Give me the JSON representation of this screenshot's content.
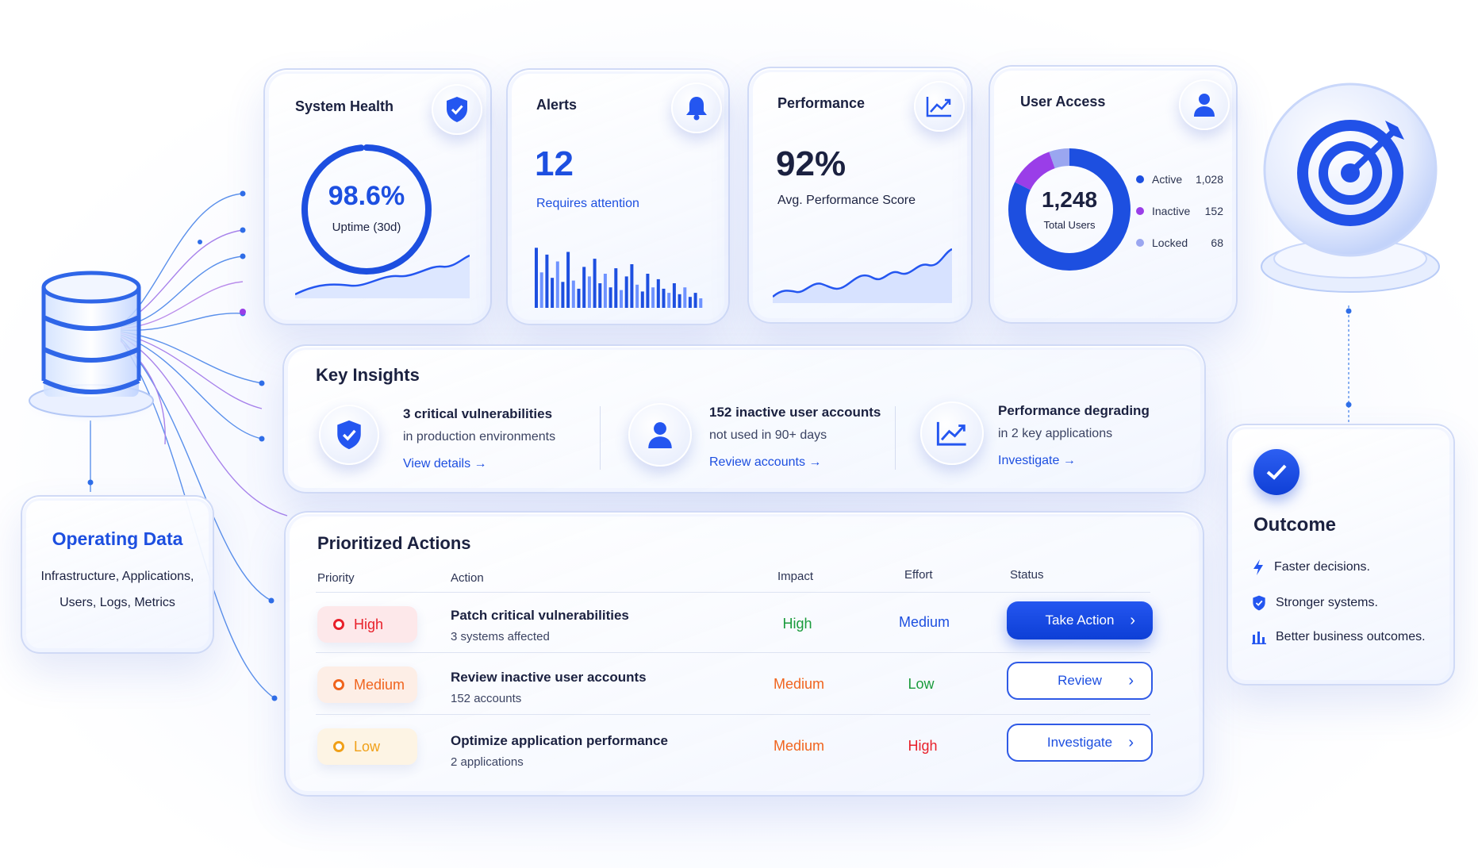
{
  "colors": {
    "accent": "#1d4fe0",
    "high": "#e8202a",
    "medium": "#f0641e",
    "low": "#f0a018",
    "green": "#1a9b3c",
    "purple": "#9a3ee8"
  },
  "system_health": {
    "title": "System Health",
    "value": "98.6%",
    "caption": "Uptime (30d)",
    "progress": 0.986,
    "icon": "shield-check-icon"
  },
  "alerts": {
    "title": "Alerts",
    "count": "12",
    "caption": "Requires attention",
    "icon": "bell-icon",
    "bars": [
      0.88,
      0.52,
      0.78,
      0.44,
      0.68,
      0.38,
      0.82,
      0.4,
      0.28,
      0.6,
      0.46,
      0.72,
      0.36,
      0.5,
      0.3,
      0.58,
      0.26,
      0.46,
      0.64,
      0.34,
      0.24,
      0.5,
      0.3,
      0.42,
      0.28,
      0.22,
      0.36,
      0.2,
      0.3,
      0.16,
      0.22,
      0.14
    ]
  },
  "performance": {
    "title": "Performance",
    "value": "92%",
    "caption": "Avg. Performance Score",
    "icon": "trend-up-icon"
  },
  "user_access": {
    "title": "User Access",
    "total": "1,248",
    "caption": "Total Users",
    "icon": "user-icon",
    "legend": [
      {
        "label": "Active",
        "value": "1,028",
        "color": "#1d4fe0"
      },
      {
        "label": "Inactive",
        "value": "152",
        "color": "#9a3ee8"
      },
      {
        "label": "Locked",
        "value": "68",
        "color": "#9aa6f0"
      }
    ]
  },
  "operating_data": {
    "title": "Operating Data",
    "line1": "Infrastructure, Applications,",
    "line2": "Users, Logs, Metrics",
    "icon": "database-icon"
  },
  "key_insights": {
    "title": "Key Insights",
    "items": [
      {
        "title": "3 critical vulnerabilities",
        "sub": "in production environments",
        "link": "View details →",
        "icon": "shield-check-icon"
      },
      {
        "title": "152 inactive user accounts",
        "sub": "not used in 90+ days",
        "link": "Review accounts →",
        "icon": "user-icon"
      },
      {
        "title": "Performance degrading",
        "sub": "in 2 key applications",
        "link": "Investigate →",
        "icon": "trend-up-icon"
      }
    ]
  },
  "actions": {
    "title": "Prioritized Actions",
    "columns": {
      "priority": "Priority",
      "action": "Action",
      "impact": "Impact",
      "effort": "Effort",
      "status": "Status"
    },
    "rows": [
      {
        "priority": "High",
        "title": "Patch critical vulnerabilities",
        "sub": "3 systems affected",
        "impact": "High",
        "effort": "Medium",
        "button": "Take Action"
      },
      {
        "priority": "Medium",
        "title": "Review inactive user accounts",
        "sub": "152 accounts",
        "impact": "Medium",
        "effort": "Low",
        "button": "Review"
      },
      {
        "priority": "Low",
        "title": "Optimize application performance",
        "sub": "2 applications",
        "impact": "Medium",
        "effort": "High",
        "button": "Investigate"
      }
    ]
  },
  "outcome": {
    "title": "Outcome",
    "items": [
      {
        "text": "Faster decisions.",
        "icon": "lightning-icon"
      },
      {
        "text": "Stronger systems.",
        "icon": "shield-check-icon"
      },
      {
        "text": "Better business outcomes.",
        "icon": "bar-chart-icon"
      }
    ]
  },
  "target": {
    "icon": "target-icon"
  }
}
